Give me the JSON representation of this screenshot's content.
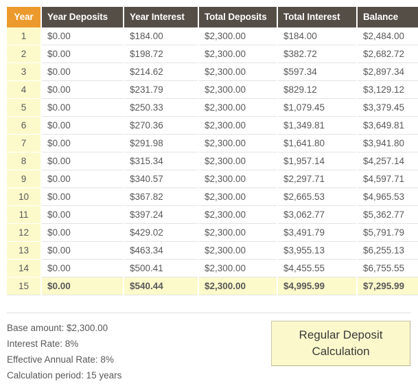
{
  "table": {
    "columns": [
      {
        "key": "year",
        "label": "Year"
      },
      {
        "key": "ydep",
        "label": "Year Deposits"
      },
      {
        "key": "yint",
        "label": "Year Interest"
      },
      {
        "key": "tdep",
        "label": "Total Deposits"
      },
      {
        "key": "tint",
        "label": "Total Interest"
      },
      {
        "key": "bal",
        "label": "Balance"
      }
    ],
    "rows": [
      {
        "year": "1",
        "ydep": "$0.00",
        "yint": "$184.00",
        "tdep": "$2,300.00",
        "tint": "$184.00",
        "bal": "$2,484.00"
      },
      {
        "year": "2",
        "ydep": "$0.00",
        "yint": "$198.72",
        "tdep": "$2,300.00",
        "tint": "$382.72",
        "bal": "$2,682.72"
      },
      {
        "year": "3",
        "ydep": "$0.00",
        "yint": "$214.62",
        "tdep": "$2,300.00",
        "tint": "$597.34",
        "bal": "$2,897.34"
      },
      {
        "year": "4",
        "ydep": "$0.00",
        "yint": "$231.79",
        "tdep": "$2,300.00",
        "tint": "$829.12",
        "bal": "$3,129.12"
      },
      {
        "year": "5",
        "ydep": "$0.00",
        "yint": "$250.33",
        "tdep": "$2,300.00",
        "tint": "$1,079.45",
        "bal": "$3,379.45"
      },
      {
        "year": "6",
        "ydep": "$0.00",
        "yint": "$270.36",
        "tdep": "$2,300.00",
        "tint": "$1,349.81",
        "bal": "$3,649.81"
      },
      {
        "year": "7",
        "ydep": "$0.00",
        "yint": "$291.98",
        "tdep": "$2,300.00",
        "tint": "$1,641.80",
        "bal": "$3,941.80"
      },
      {
        "year": "8",
        "ydep": "$0.00",
        "yint": "$315.34",
        "tdep": "$2,300.00",
        "tint": "$1,957.14",
        "bal": "$4,257.14"
      },
      {
        "year": "9",
        "ydep": "$0.00",
        "yint": "$340.57",
        "tdep": "$2,300.00",
        "tint": "$2,297.71",
        "bal": "$4,597.71"
      },
      {
        "year": "10",
        "ydep": "$0.00",
        "yint": "$367.82",
        "tdep": "$2,300.00",
        "tint": "$2,665.53",
        "bal": "$4,965.53"
      },
      {
        "year": "11",
        "ydep": "$0.00",
        "yint": "$397.24",
        "tdep": "$2,300.00",
        "tint": "$3,062.77",
        "bal": "$5,362.77"
      },
      {
        "year": "12",
        "ydep": "$0.00",
        "yint": "$429.02",
        "tdep": "$2,300.00",
        "tint": "$3,491.79",
        "bal": "$5,791.79"
      },
      {
        "year": "13",
        "ydep": "$0.00",
        "yint": "$463.34",
        "tdep": "$2,300.00",
        "tint": "$3,955.13",
        "bal": "$6,255.13"
      },
      {
        "year": "14",
        "ydep": "$0.00",
        "yint": "$500.41",
        "tdep": "$2,300.00",
        "tint": "$4,455.55",
        "bal": "$6,755.55"
      },
      {
        "year": "15",
        "ydep": "$0.00",
        "yint": "$540.44",
        "tdep": "$2,300.00",
        "tint": "$4,995.99",
        "bal": "$7,295.99",
        "total": true
      }
    ]
  },
  "summary": {
    "lines": [
      "Base amount: $2,300.00",
      "Interest Rate: 8%",
      "Effective Annual Rate: 8%",
      "Calculation period: 15 years"
    ]
  },
  "calc_button": {
    "line1": "Regular Deposit",
    "line2": "Calculation"
  },
  "colors": {
    "header_accent": "#ec9a2e",
    "header_dark": "#554e46",
    "row_highlight": "#fcfacb",
    "button_bg": "#fbf8cc",
    "text": "#58585a"
  }
}
